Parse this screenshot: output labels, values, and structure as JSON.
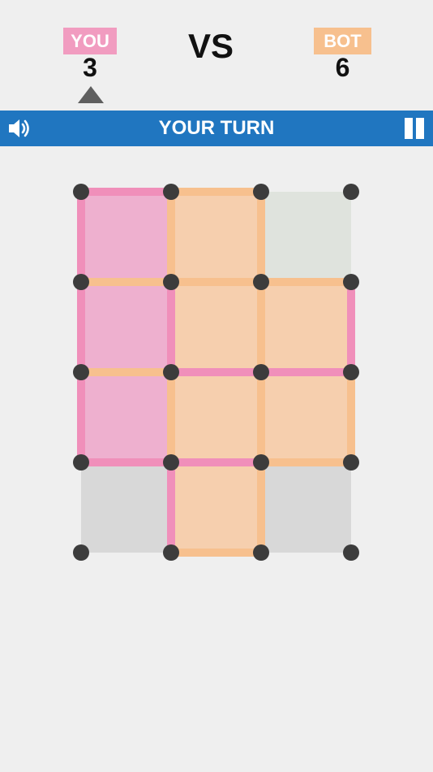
{
  "scoreboard": {
    "you": {
      "label": "YOU",
      "score": "3",
      "color": "#f19cc0"
    },
    "bot": {
      "label": "BOT",
      "score": "6",
      "color": "#f7c08e"
    },
    "vs": "VS",
    "turn": "you"
  },
  "status_bar": {
    "text": "YOUR TURN",
    "color": "#2076c0",
    "left_icon": "speaker-icon",
    "right_icon": "pause-icon"
  },
  "board": {
    "cols": 3,
    "rows": 4,
    "colors": {
      "you_fill": "#eeb0cf",
      "bot_fill": "#f6cfae",
      "empty_fill": "#d8d8d8",
      "pending_fill": "#dfe3dd",
      "you_line": "#f08fba",
      "bot_line": "#f7c08e",
      "dot": "#3c3c3c"
    },
    "boxes": [
      [
        "you",
        "bot",
        "pending"
      ],
      [
        "you",
        "bot",
        "bot"
      ],
      [
        "you",
        "bot",
        "bot"
      ],
      [
        "empty",
        "bot",
        "empty"
      ]
    ],
    "h_edges": [
      [
        "you",
        "bot",
        null
      ],
      [
        "bot",
        "bot",
        "bot"
      ],
      [
        "bot",
        "you",
        "you"
      ],
      [
        "you",
        "you",
        "bot"
      ],
      [
        null,
        "bot",
        null
      ]
    ],
    "v_edges": [
      [
        "you",
        "bot",
        "bot",
        null
      ],
      [
        "you",
        "you",
        "bot",
        "you"
      ],
      [
        "you",
        "bot",
        "bot",
        "bot"
      ],
      [
        null,
        "you",
        "bot",
        null
      ]
    ]
  }
}
